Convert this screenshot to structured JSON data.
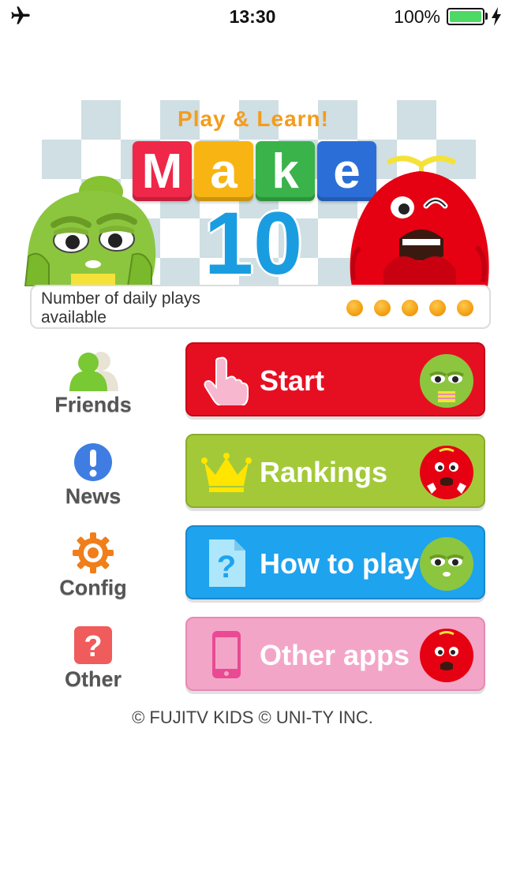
{
  "status_bar": {
    "time": "13:30",
    "battery_percent": "100%",
    "battery_level": 1.0,
    "icons": [
      "airplane-icon",
      "battery-icon",
      "charging-bolt-icon"
    ]
  },
  "banner": {
    "tagline": "Play & Learn!",
    "title_letters": [
      "M",
      "a",
      "k",
      "e"
    ],
    "title_number": "10",
    "plays_label": "Number of daily plays available",
    "plays_remaining": 5,
    "plays_total": 5,
    "colors": {
      "tile_1": "#ef2748",
      "tile_2": "#f7b413",
      "tile_3": "#39b34a",
      "tile_4": "#2c6ed8",
      "accent": "#1a9de0"
    }
  },
  "side_nav": {
    "items": [
      {
        "label": "Friends",
        "icon": "friends-icon"
      },
      {
        "label": "News",
        "icon": "exclamation-icon"
      },
      {
        "label": "Config",
        "icon": "gear-icon"
      },
      {
        "label": "Other",
        "icon": "question-icon"
      }
    ]
  },
  "actions": {
    "items": [
      {
        "label": "Start",
        "icon": "pointing-hand-icon",
        "color": "#e60f22"
      },
      {
        "label": "Rankings",
        "icon": "crown-icon",
        "color": "#a3c939"
      },
      {
        "label": "How to play",
        "icon": "help-document-icon",
        "color": "#1ea3ef"
      },
      {
        "label": "Other apps",
        "icon": "smartphone-icon",
        "color": "#f3a5c8"
      }
    ]
  },
  "footer": {
    "copyright": "© FUJITV KIDS © UNI-TY INC."
  }
}
